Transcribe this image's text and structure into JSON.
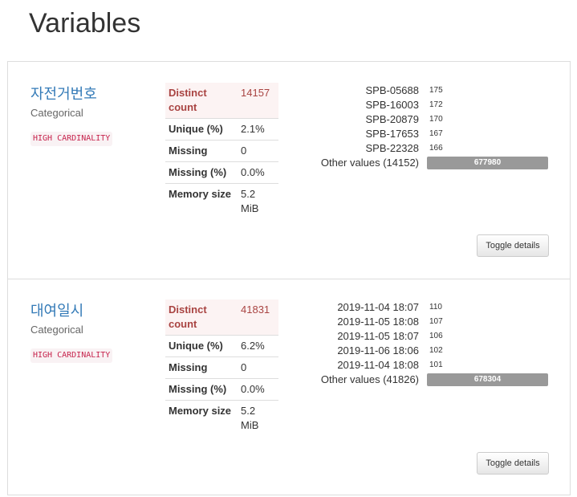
{
  "page_title": "Variables",
  "variables": [
    {
      "name": "자전거번호",
      "type": "Categorical",
      "badge": "HIGH CARDINALITY",
      "stats": [
        {
          "label": "Distinct count",
          "value": "14157",
          "alert": true
        },
        {
          "label": "Unique (%)",
          "value": "2.1%",
          "alert": false
        },
        {
          "label": "Missing",
          "value": "0",
          "alert": false
        },
        {
          "label": "Missing (%)",
          "value": "0.0%",
          "alert": false
        },
        {
          "label": "Memory size",
          "value": "5.2 MiB",
          "alert": false
        }
      ],
      "frequencies": [
        {
          "value": "SPB-05688",
          "count": "175"
        },
        {
          "value": "SPB-16003",
          "count": "172"
        },
        {
          "value": "SPB-20879",
          "count": "170"
        },
        {
          "value": "SPB-17653",
          "count": "167"
        },
        {
          "value": "SPB-22328",
          "count": "166"
        }
      ],
      "other": {
        "label": "Other values (14152)",
        "count": "677980"
      },
      "toggle_label": "Toggle details"
    },
    {
      "name": "대여일시",
      "type": "Categorical",
      "badge": "HIGH CARDINALITY",
      "stats": [
        {
          "label": "Distinct count",
          "value": "41831",
          "alert": true
        },
        {
          "label": "Unique (%)",
          "value": "6.2%",
          "alert": false
        },
        {
          "label": "Missing",
          "value": "0",
          "alert": false
        },
        {
          "label": "Missing (%)",
          "value": "0.0%",
          "alert": false
        },
        {
          "label": "Memory size",
          "value": "5.2 MiB",
          "alert": false
        }
      ],
      "frequencies": [
        {
          "value": "2019-11-04 18:07",
          "count": "110"
        },
        {
          "value": "2019-11-05 18:08",
          "count": "107"
        },
        {
          "value": "2019-11-05 18:07",
          "count": "106"
        },
        {
          "value": "2019-11-06 18:06",
          "count": "102"
        },
        {
          "value": "2019-11-04 18:08",
          "count": "101"
        }
      ],
      "other": {
        "label": "Other values (41826)",
        "count": "678304"
      },
      "toggle_label": "Toggle details"
    }
  ]
}
